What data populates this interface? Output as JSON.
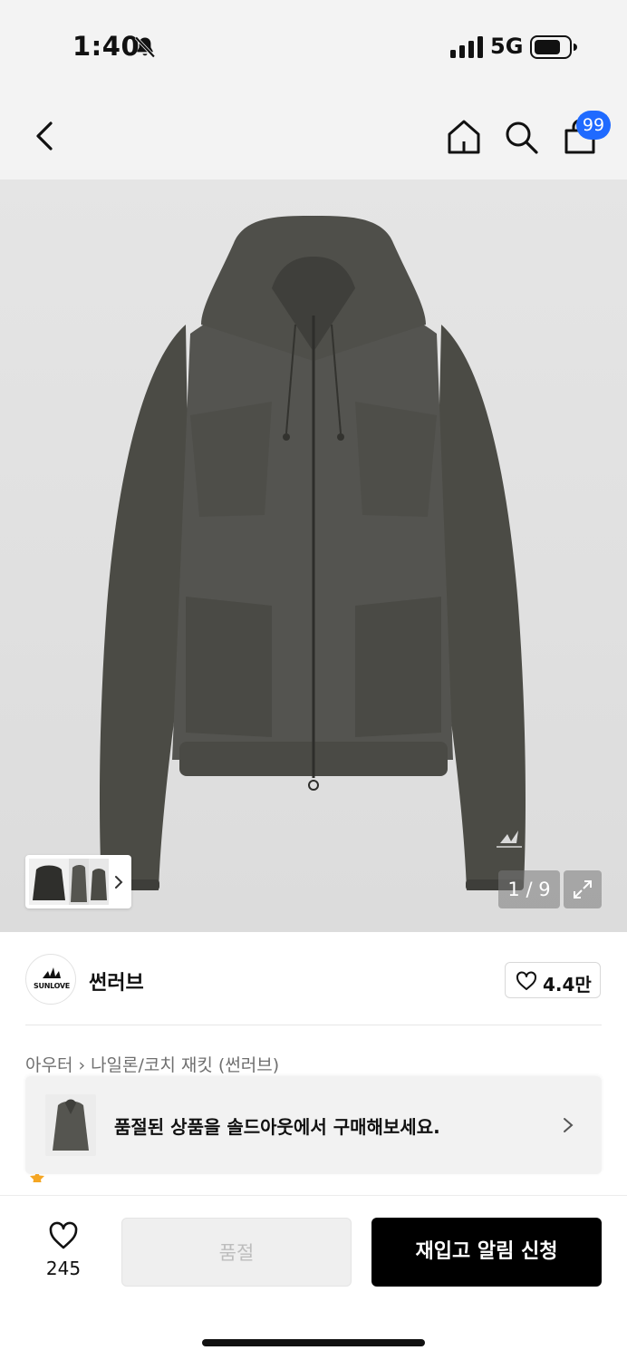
{
  "status_bar": {
    "time": "1:40",
    "network": "5G",
    "icons": [
      "bell-slash-icon",
      "signal-icon",
      "battery-icon"
    ]
  },
  "nav": {
    "icons": [
      "back-icon",
      "home-icon",
      "search-icon",
      "shopping-bag-icon"
    ],
    "cart_badge": "99"
  },
  "gallery": {
    "counter": "1 / 9",
    "current_index": 1,
    "total": 9,
    "icons": [
      "expand-icon",
      "chevron-right-icon"
    ]
  },
  "brand": {
    "name": "썬러브",
    "logo_text": "SUNLOVE",
    "like_count": "4.4만"
  },
  "breadcrumb": {
    "category": "아우터",
    "subcategory": "나일론/코치 재킷 (썬러브)"
  },
  "toast": {
    "message": "품절된 상품을 솔드아웃에서 구매해보세요."
  },
  "action_bar": {
    "wish_count": "245",
    "soldout_label": "품절",
    "restock_label": "재입고 알림 신청"
  },
  "colors": {
    "accent_badge": "#1f6aff",
    "primary_button": "#000000",
    "disabled_button": "#efefef",
    "star": "#f5a623"
  }
}
